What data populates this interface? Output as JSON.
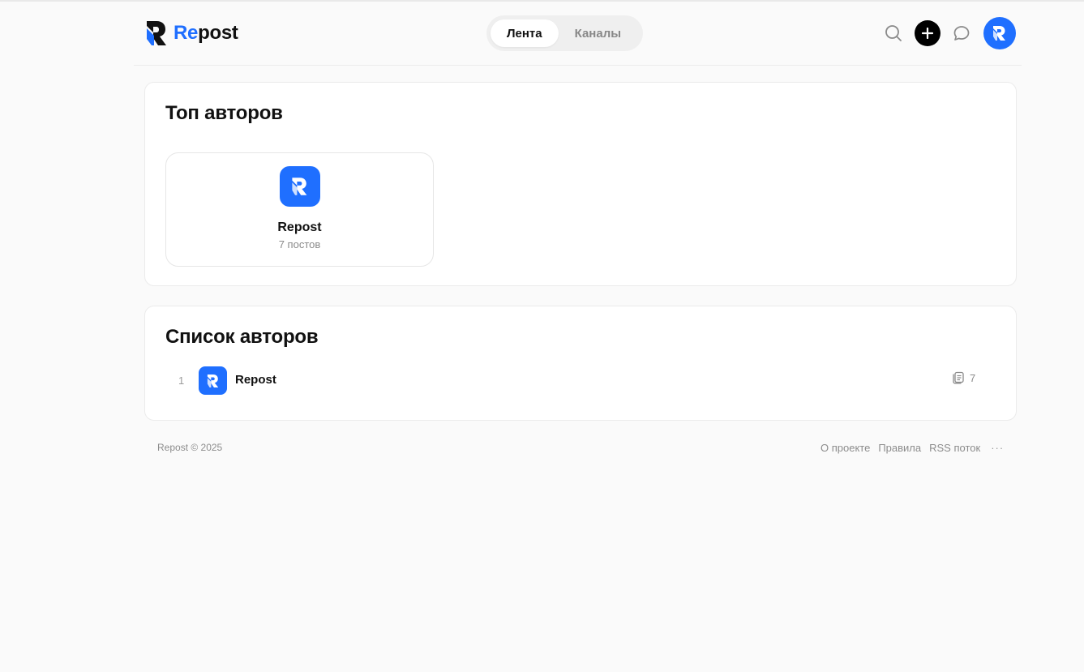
{
  "brand": {
    "prefix": "Re",
    "suffix": "post",
    "accent": "#1f6fff"
  },
  "header": {
    "tabs": [
      {
        "label": "Лента",
        "active": true
      },
      {
        "label": "Каналы",
        "active": false
      }
    ],
    "icons": [
      "search-icon",
      "plus-icon",
      "chat-icon",
      "user-avatar"
    ]
  },
  "top_authors": {
    "title": "Топ авторов",
    "items": [
      {
        "name": "Repost",
        "posts": "7 постов"
      }
    ]
  },
  "authors_list": {
    "title": "Список авторов",
    "rows": [
      {
        "rank": "1",
        "name": "Repost",
        "posts": "7"
      }
    ]
  },
  "footer": {
    "copyright": "Repost © 2025",
    "links": [
      "О проекте",
      "Правила",
      "RSS поток"
    ],
    "more": "···"
  }
}
